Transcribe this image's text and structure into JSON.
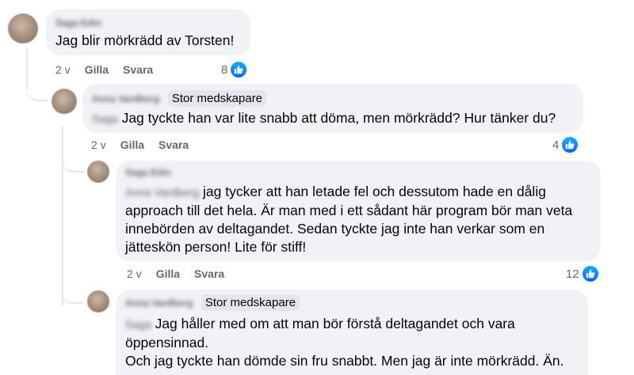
{
  "comments": [
    {
      "author": "Saga Edin",
      "badge": "",
      "mention": "",
      "text": "Jag blir mörkrädd av Torsten!",
      "time": "2 v",
      "like_label": "Gilla",
      "reply_label": "Svara",
      "reaction_count": "8"
    },
    {
      "author": "Anna Vardberg",
      "badge": "Stor medskapare",
      "mention": "Saga",
      "text": "Jag tyckte han var lite snabb att döma, men mörkrädd? Hur tänker du?",
      "time": "2 v",
      "like_label": "Gilla",
      "reply_label": "Svara",
      "reaction_count": "4"
    },
    {
      "author": "Saga Edin",
      "badge": "",
      "mention": "Anna Vardberg",
      "text_lines": [
        "jag tycker att han letade fel och dessutom hade en dålig",
        "approach till det hela. Är man med i ett sådant här program bör man veta",
        "innebörden av deltagandet. Sedan tyckte jag inte han verkar som en",
        "jätteskön person! Lite för stiff!"
      ],
      "time": "2 v",
      "like_label": "Gilla",
      "reply_label": "Svara",
      "reaction_count": "12"
    },
    {
      "author": "Anna Vardberg",
      "badge": "Stor medskapare",
      "mention": "Saga",
      "text_lines": [
        "Jag håller med om att man bör förstå deltagandet och vara",
        "öppensinnad.",
        "Och jag tyckte han dömde sin fru snabbt. Men jag är inte mörkrädd. Än."
      ]
    }
  ],
  "colors": {
    "bubble": "#f0f2f5",
    "like_blue": "#0866ff",
    "meta_gray": "#65676b"
  }
}
